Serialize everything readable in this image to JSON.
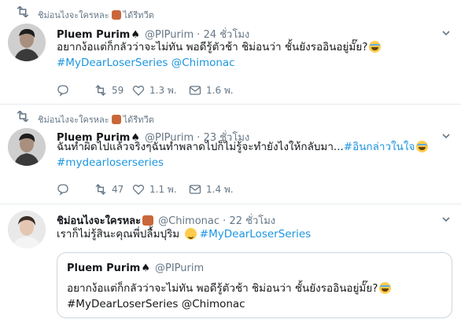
{
  "tweets": [
    {
      "retweet_label": "ชิม่อนไงจะใครหละ",
      "retweet_suffix": "ได้รีทวีต",
      "name": "Pluem Purim",
      "spade": "♠",
      "handle": "@PIPurim",
      "dot": "·",
      "time": "24 ชั่วโมง",
      "line1": "อยากง้อแต่ก็กลัวว่าจะไม่ทัน พอดีรู้ตัวช้า ชิม่อนว่า ชั้นยังรออินอยู่มั๊ย?",
      "line2": "#MyDearLoserSeries @Chimonac",
      "replies": "",
      "retweets": "59",
      "likes": "1.3 พ.",
      "views": "1.6 พ."
    },
    {
      "retweet_label": "ชิม่อนไงจะใครหละ",
      "retweet_suffix": "ได้รีทวีต",
      "name": "Pluem Purim",
      "spade": "♠",
      "handle": "@PIPurim",
      "dot": "·",
      "time": "23 ชั่วโมง",
      "line1_text": "ฉันทำผิดไปแล้วจริงๆฉันทำพลาดไปก็ไม่รู้จะทำยังไงให้กลับมา...",
      "line1_tag": "#อินกล่าวในใจ",
      "line2": "#mydearloserseries",
      "retweets": "47",
      "likes": "1.1 พ.",
      "views": "1.4 พ."
    },
    {
      "name": "ชิม่อนไงจะใครหละ",
      "handle": "@Chimonac",
      "dot": "·",
      "time": "22 ชั่วโมง",
      "line1_text": "เราก็ไม่รู้สินะคุณพี่ปลื้มปุริม",
      "line1_tag": "#MyDearLoserSeries",
      "quote": {
        "name": "Pluem Purim",
        "spade": "♠",
        "handle": "@PIPurim",
        "line1": "อยากง้อแต่ก็กลัวว่าจะไม่ทัน พอดีรู้ตัวช้า ชิม่อนว่า ชั้นยังรออินอยู่มั๊ย?",
        "line2": "#MyDearLoserSeries @Chimonac"
      }
    }
  ],
  "icons": {
    "retweet": "retweet-icon",
    "reply": "reply-icon",
    "like": "heart-icon",
    "views": "message-icon",
    "more": "chevron-down-icon"
  },
  "colors": {
    "link": "#1b95e0",
    "muted": "#657786",
    "border": "#e6ecf0"
  }
}
